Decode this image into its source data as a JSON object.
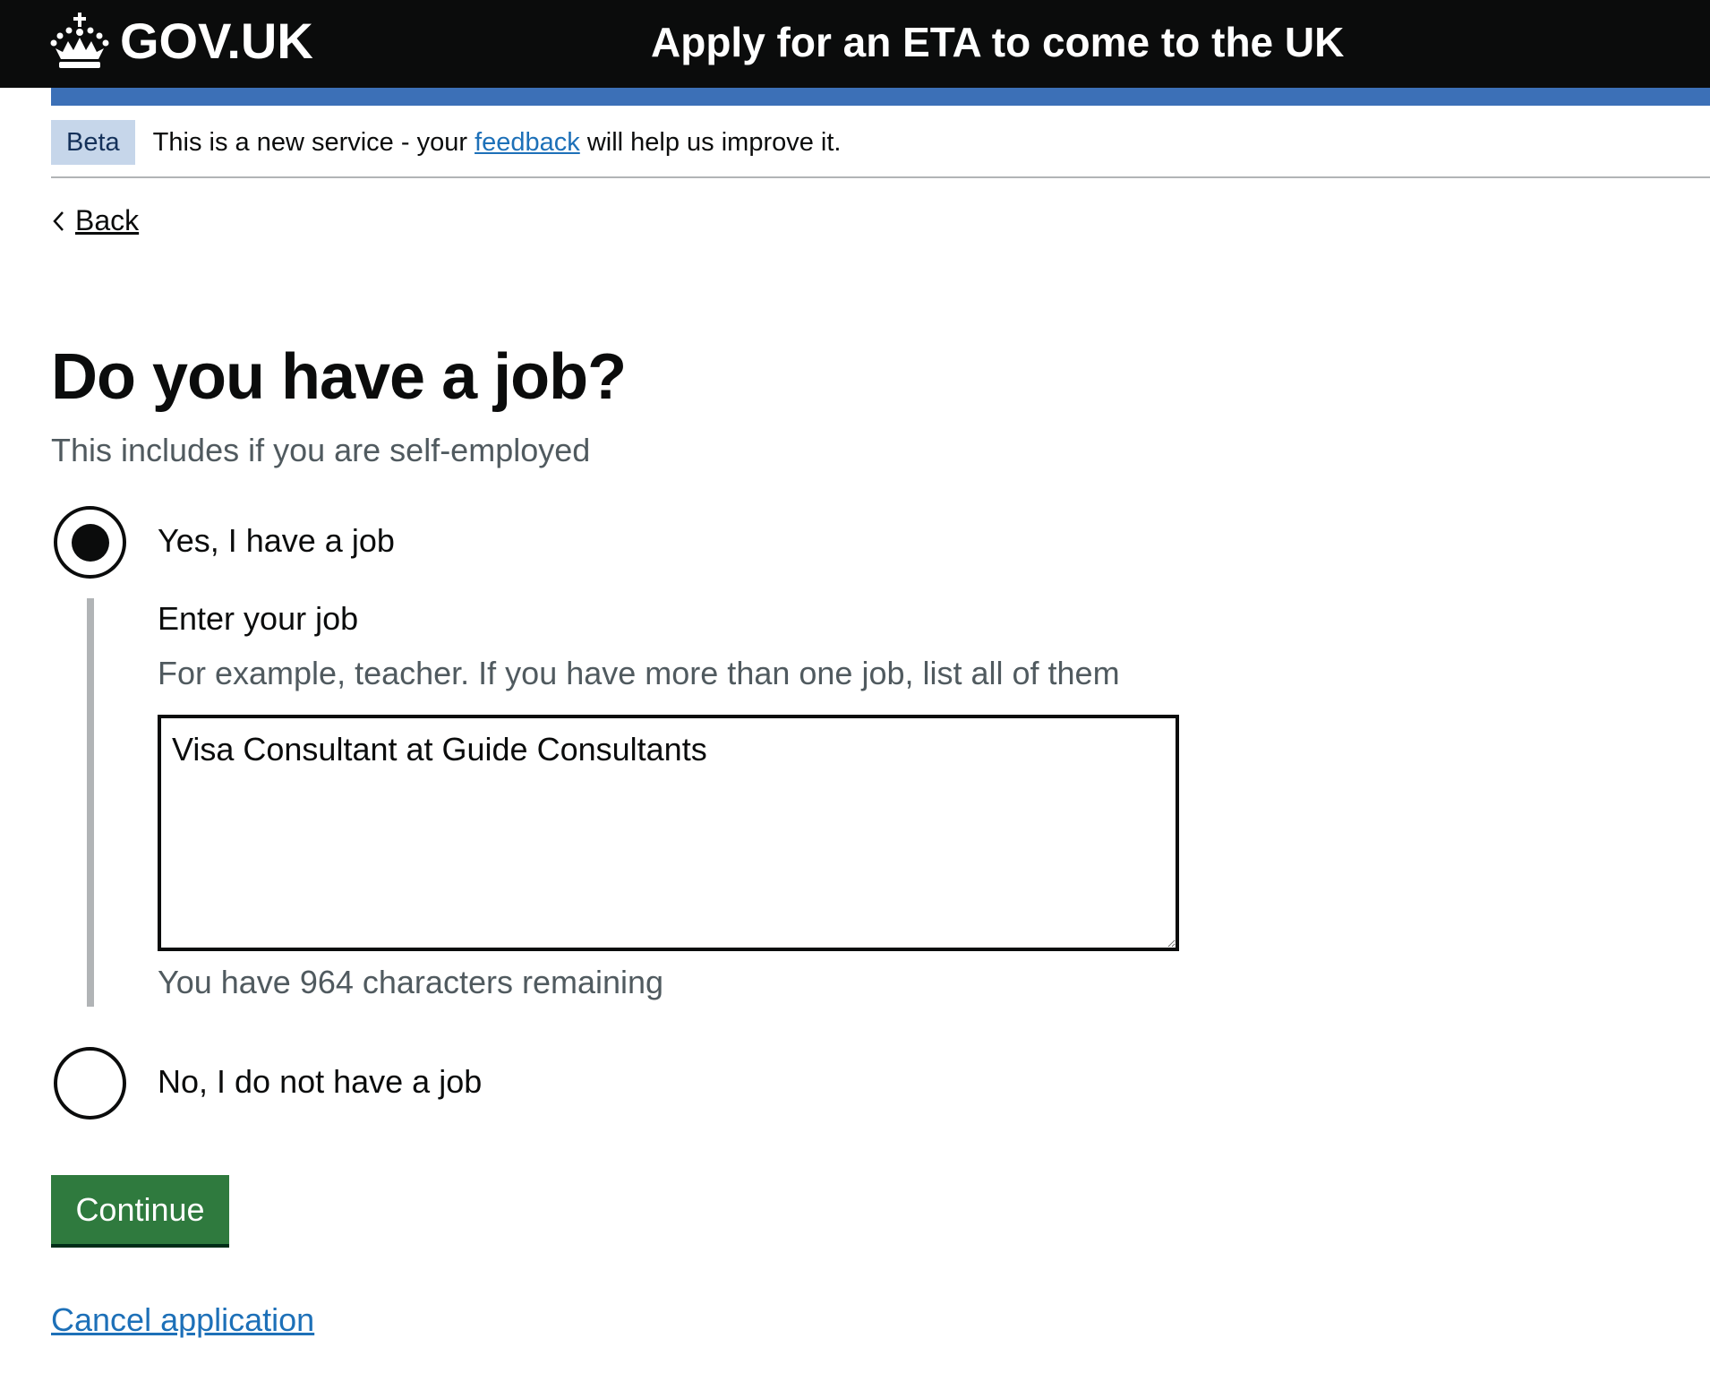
{
  "header": {
    "logo_text": "GOV.UK",
    "service_name": "Apply for an ETA to come to the UK"
  },
  "phase_banner": {
    "tag": "Beta",
    "text_before": "This is a new service - your",
    "link": "feedback",
    "text_after": "will help us improve it."
  },
  "back_link": "Back",
  "question": {
    "title": "Do you have a job?",
    "hint": "This includes if you are self-employed"
  },
  "options": [
    {
      "label": "Yes, I have a job",
      "selected": true
    },
    {
      "label": "No, I do not have a job",
      "selected": false
    }
  ],
  "job_field": {
    "label": "Enter your job",
    "hint": "For example, teacher. If you have more than one job, list all of them",
    "value": "Visa Consultant at Guide Consultants",
    "count_message": "You have 964 characters remaining"
  },
  "continue_label": "Continue",
  "cancel_label": "Cancel application",
  "colors": {
    "header_bg": "#0b0c0c",
    "header_bar": "#3c70b7",
    "link": "#1d70b8",
    "button": "#2f7a3e",
    "hint_text": "#505a5f"
  },
  "icons": [
    "crown-icon",
    "chevron-left-icon"
  ]
}
